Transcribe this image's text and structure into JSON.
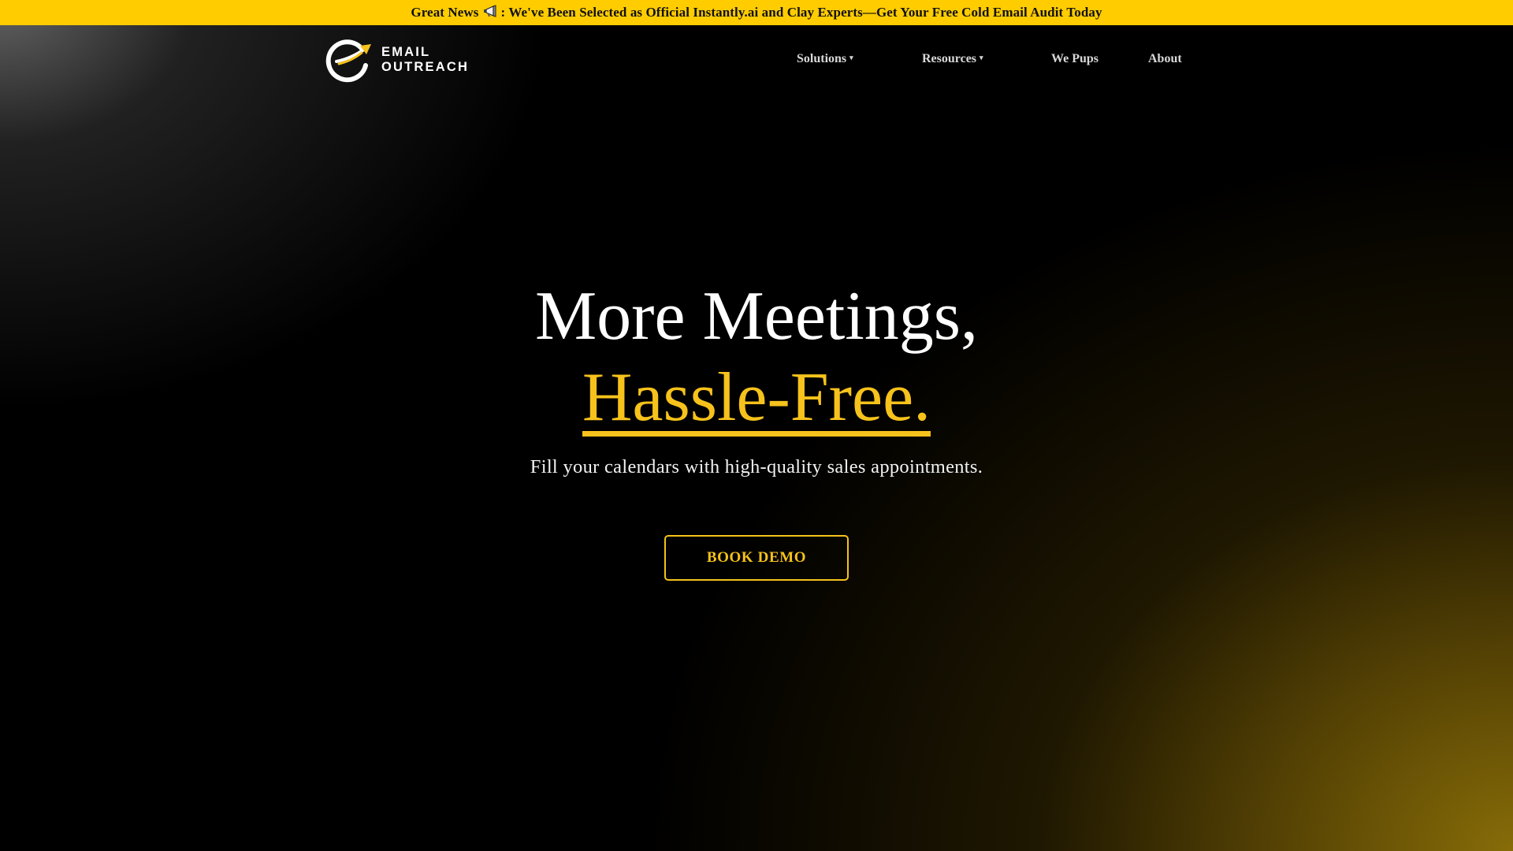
{
  "announcement": {
    "prefix": "Great News",
    "icon": "megaphone-icon",
    "text": ": We've Been Selected as Official Instantly.ai and Clay Experts—Get Your Free Cold Email Audit Today"
  },
  "logo": {
    "line1": "EMAIL",
    "line2": "OUTREACH"
  },
  "nav": {
    "items": [
      {
        "label": "Solutions",
        "has_dropdown": true
      },
      {
        "label": "Resources",
        "has_dropdown": true
      },
      {
        "label": "We Pups",
        "has_dropdown": false
      },
      {
        "label": "About",
        "has_dropdown": false
      }
    ],
    "caret": "▾"
  },
  "hero": {
    "line1": "More Meetings,",
    "line2": "Hassle-Free.",
    "subtitle": "Fill your calendars with high-quality sales appointments.",
    "cta": "BOOK DEMO"
  },
  "colors": {
    "accent": "#f6c21b",
    "announce_bg": "#ffcc00",
    "background": "#000000"
  }
}
